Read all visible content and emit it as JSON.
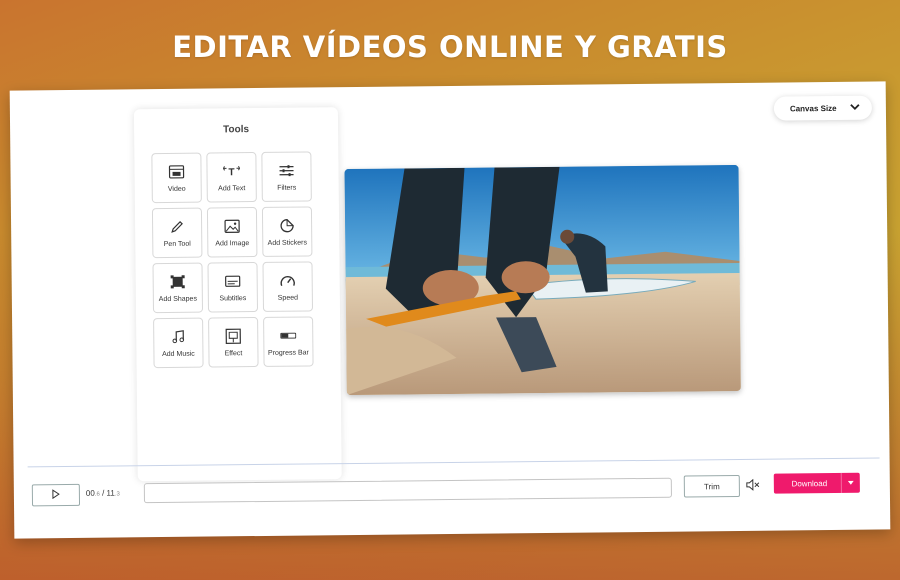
{
  "headline": "EDITAR VÍDEOS ONLINE Y GRATIS",
  "tools": {
    "title": "Tools",
    "items": [
      {
        "label": "Video",
        "icon": "video-icon"
      },
      {
        "label": "Add Text",
        "icon": "text-icon"
      },
      {
        "label": "Filters",
        "icon": "filters-icon"
      },
      {
        "label": "Pen Tool",
        "icon": "pen-icon"
      },
      {
        "label": "Add Image",
        "icon": "image-icon"
      },
      {
        "label": "Add Stickers",
        "icon": "sticker-icon"
      },
      {
        "label": "Add Shapes",
        "icon": "shapes-icon"
      },
      {
        "label": "Subtitles",
        "icon": "subtitles-icon"
      },
      {
        "label": "Speed",
        "icon": "speed-icon"
      },
      {
        "label": "Add Music",
        "icon": "music-icon"
      },
      {
        "label": "Effect",
        "icon": "effect-icon"
      },
      {
        "label": "Progress Bar",
        "icon": "progress-bar-icon"
      }
    ]
  },
  "canvas_size": {
    "label": "Canvas Size",
    "icon": "chevron-down-icon"
  },
  "player": {
    "current_time": "00",
    "current_frac": ".6",
    "separator": " / ",
    "total_time": "11",
    "total_frac": ".3",
    "trim_label": "Trim",
    "download_label": "Download"
  },
  "colors": {
    "accent": "#ef1a6c"
  }
}
